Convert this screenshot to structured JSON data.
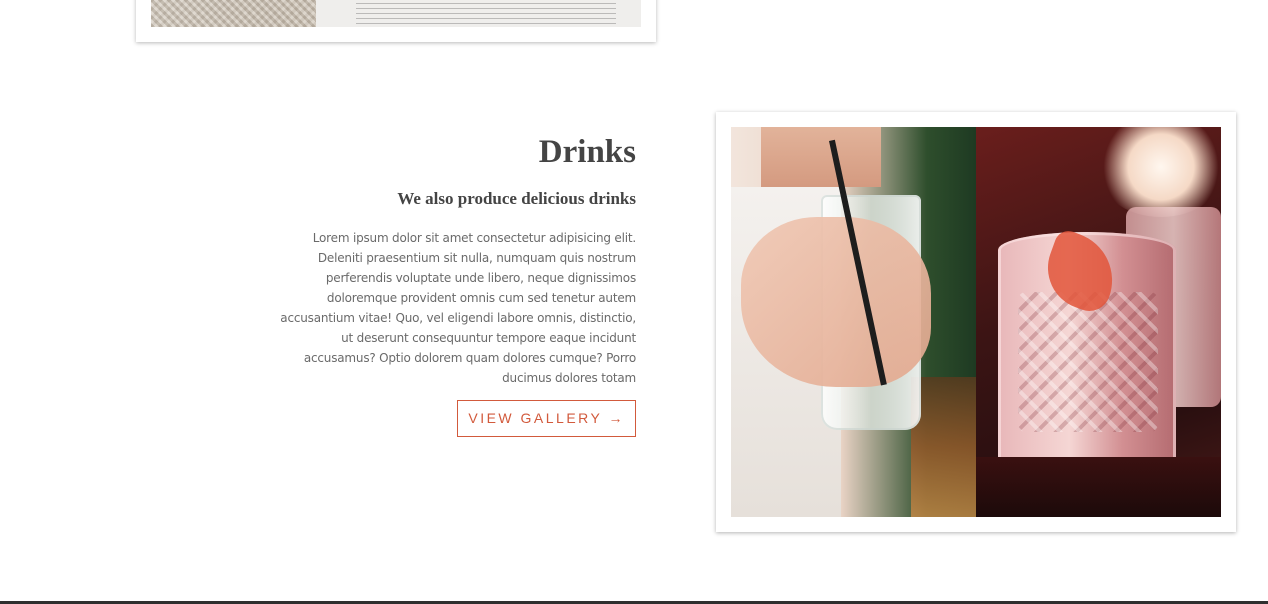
{
  "top_section": {
    "image_alt": "Open book on woven placemat"
  },
  "drinks_section": {
    "title": "Drinks",
    "subtitle": "We also produce delicious drinks",
    "body": "Lorem ipsum dolor sit amet consectetur adipisicing elit. Deleniti praesentium sit nulla, numquam quis nostrum perferendis voluptate unde libero, neque dignissimos doloremque provident omnis cum sed tenetur autem accusantium vitae! Quo, vel eligendi labore omnis, distinctio, ut deserunt consequuntur tempore eaque incidunt accusamus? Optio dolorem quam dolores cumque? Porro ducimus dolores totam",
    "button_label": "VIEW GALLERY →",
    "image_alt": "Drinks photo collage"
  },
  "colors": {
    "accent": "#d25a3c",
    "heading": "#444444",
    "body_text": "#6a6a6a"
  }
}
